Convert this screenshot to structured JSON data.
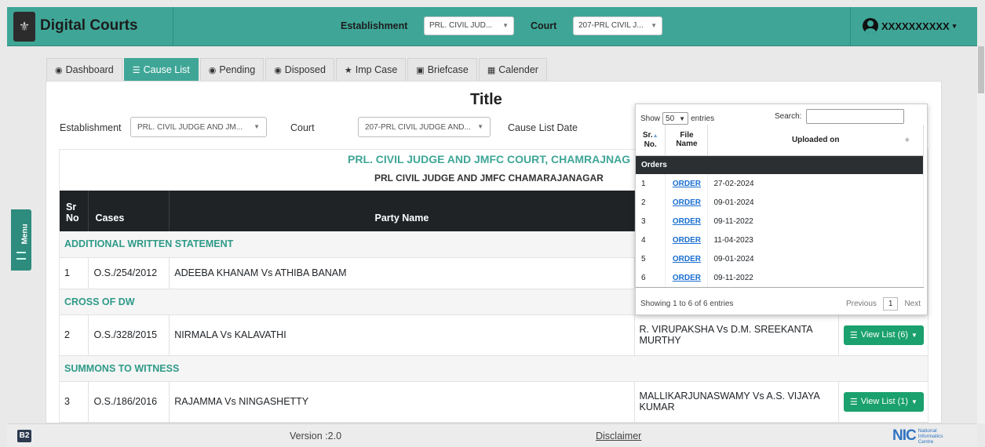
{
  "header": {
    "app_title": "Digital Courts",
    "establishment_label": "Establishment",
    "establishment_value": "PRL. CIVIL JUD...",
    "court_label": "Court",
    "court_value": "207-PRL CIVIL J...",
    "user_name": "XXXXXXXXXX"
  },
  "tabs": [
    {
      "label": "Dashboard",
      "icon": "dashboard-icon"
    },
    {
      "label": "Cause List",
      "icon": "list-icon"
    },
    {
      "label": "Pending",
      "icon": "dashboard-icon"
    },
    {
      "label": "Disposed",
      "icon": "dashboard-icon"
    },
    {
      "label": "Imp Case",
      "icon": "star-icon"
    },
    {
      "label": "Briefcase",
      "icon": "briefcase-icon"
    },
    {
      "label": "Calender",
      "icon": "calendar-icon"
    }
  ],
  "filters": {
    "title": "Title",
    "establishment_label": "Establishment",
    "establishment_value": "PRL. CIVIL JUDGE AND JM...",
    "court_label": "Court",
    "court_value": "207-PRL CIVIL JUDGE AND...",
    "cause_list_date_label": "Cause List Date"
  },
  "court": {
    "name": "PRL. CIVIL JUDGE AND JMFC COURT, CHAMRAJNAG",
    "sub": "PRL CIVIL JUDGE AND JMFC CHAMARAJANAGAR"
  },
  "table": {
    "headers": {
      "sr": "Sr",
      "no": "No",
      "cases": "Cases",
      "party": "Party Name"
    },
    "group1": "ADDITIONAL WRITTEN STATEMENT",
    "row1": {
      "sr": "1",
      "case": "O.S./254/2012",
      "party": "ADEEBA KHANAM Vs ATHIBA BANAM"
    },
    "group2": "CROSS OF DW",
    "row2": {
      "sr": "2",
      "case": "O.S./328/2015",
      "party": "NIRMALA Vs KALAVATHI",
      "extra": "R. VIRUPAKSHA Vs D.M. SREEKANTA MURTHY",
      "button": "View List (6)"
    },
    "group3": "SUMMONS TO WITNESS",
    "row3": {
      "sr": "3",
      "case": "O.S./186/2016",
      "party": "RAJAMMA Vs NINGASHETTY",
      "extra": "MALLIKARJUNASWAMY Vs A.S. VIJAYA KUMAR",
      "button": "View List (1)"
    }
  },
  "popup": {
    "show_label": "Show",
    "show_value": "50",
    "entries_label": "entries",
    "search_label": "Search:",
    "col_sr_1": "Sr.",
    "col_sr_2": "No.",
    "col_file_1": "File",
    "col_file_2": "Name",
    "col_uploaded": "Uploaded on",
    "group": "Orders",
    "rows": [
      {
        "sr": "1",
        "file": "ORDER",
        "date": "27-02-2024"
      },
      {
        "sr": "2",
        "file": "ORDER",
        "date": "09-01-2024"
      },
      {
        "sr": "3",
        "file": "ORDER",
        "date": "09-11-2022"
      },
      {
        "sr": "4",
        "file": "ORDER",
        "date": "11-04-2023"
      },
      {
        "sr": "5",
        "file": "ORDER",
        "date": "09-01-2024"
      },
      {
        "sr": "6",
        "file": "ORDER",
        "date": "09-11-2022"
      }
    ],
    "showing": "Showing 1 to 6 of 6 entries",
    "previous": "Previous",
    "page": "1",
    "next": "Next"
  },
  "side_menu": {
    "label": "Menu"
  },
  "footer": {
    "badge": "B2",
    "version": "Version :2.0",
    "disclaimer": "Disclaimer",
    "nic_short": "NIC",
    "nic_line1": "National",
    "nic_line2": "Informatics",
    "nic_line3": "Centre"
  }
}
